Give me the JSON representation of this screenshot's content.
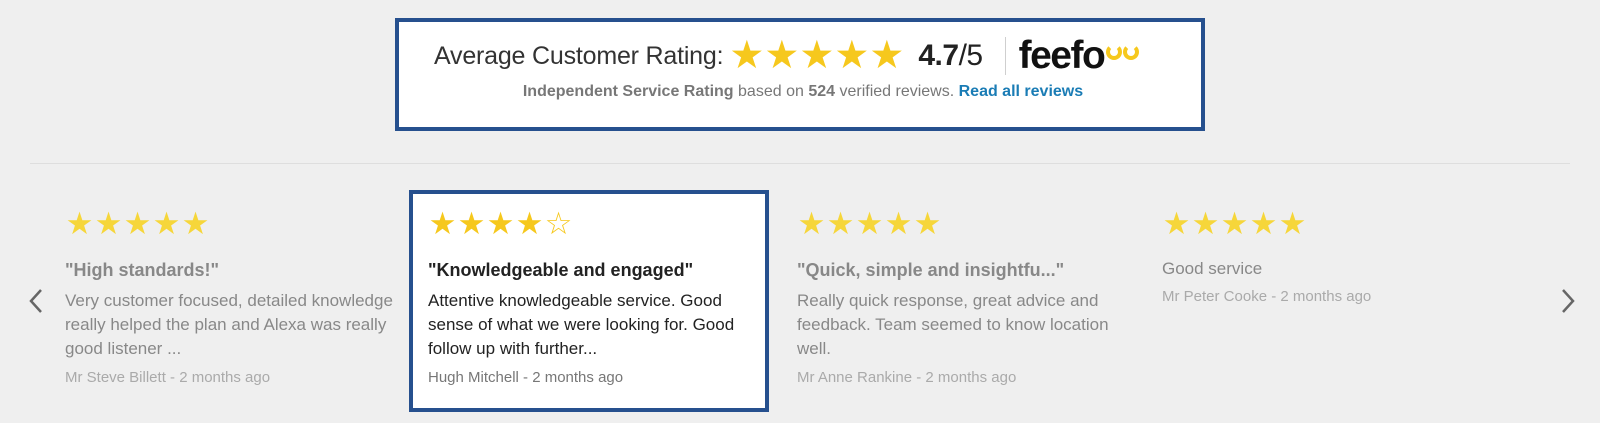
{
  "summary": {
    "label": "Average Customer Rating:",
    "rating": "4.7",
    "out_of": "/5",
    "stars": 5,
    "logo_text": "feefo",
    "text_bold": "Independent Service Rating",
    "text_mid": " based on ",
    "count": "524",
    "text_end": " verified reviews. ",
    "link": "Read all reviews"
  },
  "nav": {
    "prev_icon": "chevron-left-icon",
    "next_icon": "chevron-right-icon"
  },
  "reviews": [
    {
      "stars": 5,
      "title": "\"High standards!\"",
      "body": "Very customer focused, detailed knowledge really helped the plan and Alexa was really good listener ...",
      "meta": "Mr Steve Billett - 2 months ago"
    },
    {
      "stars": 4,
      "title": "\"Knowledgeable and engaged\"",
      "body": "Attentive knowledgeable service. Good sense of what we were looking for. Good follow up with further...",
      "meta": "Hugh Mitchell - 2 months ago"
    },
    {
      "stars": 5,
      "title": "\"Quick, simple and insightfu...\"",
      "body": "Really quick response, great advice and feedback. Team seemed to know location well.",
      "meta": "Mr Anne Rankine - 2 months ago"
    },
    {
      "stars": 5,
      "title": "Good service",
      "body": "",
      "meta": "Mr Peter Cooke - 2 months ago"
    }
  ],
  "colors": {
    "accent_border": "#26508e",
    "star": "#f6c81d",
    "link": "#1a7cb5"
  }
}
